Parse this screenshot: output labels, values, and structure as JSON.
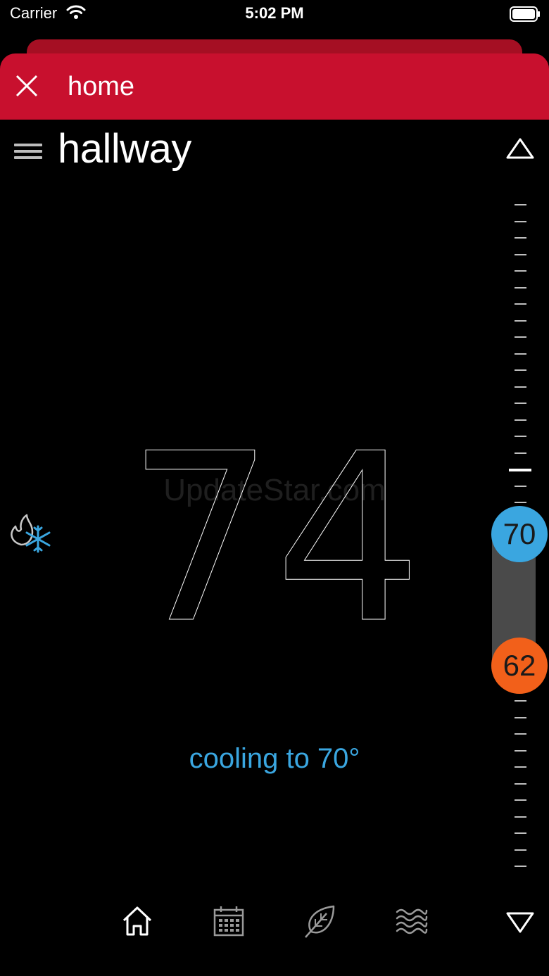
{
  "status_bar": {
    "carrier": "Carrier",
    "time": "5:02 PM"
  },
  "header": {
    "title": "home"
  },
  "room": {
    "name": "hallway"
  },
  "watermark": "UpdateStar.com",
  "thermostat": {
    "current_temp": "74",
    "status": "cooling to 70°",
    "cool_setpoint": "70",
    "heat_setpoint": "62"
  },
  "colors": {
    "header_red": "#c8102e",
    "cool_blue": "#3aa6e0",
    "heat_orange": "#f2601a"
  },
  "icons": {
    "close": "close-icon",
    "menu": "menu-icon",
    "mode": "flame-snowflake-icon",
    "nav": [
      "home-icon",
      "calendar-icon",
      "leaf-icon",
      "waves-icon"
    ]
  }
}
